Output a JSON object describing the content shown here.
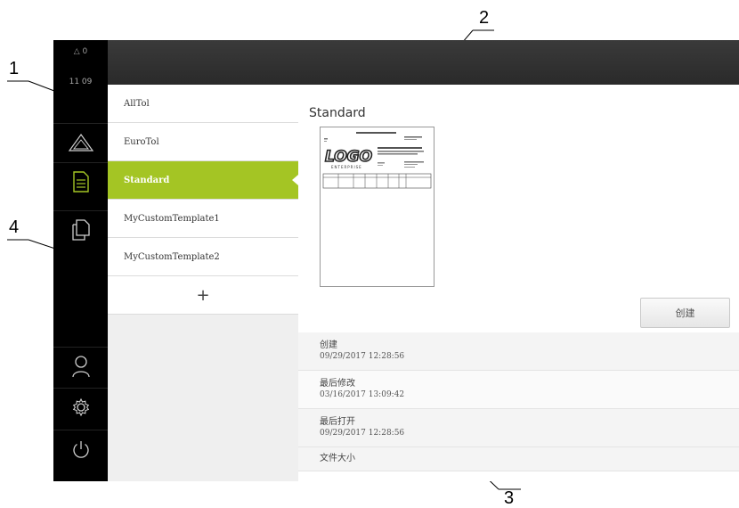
{
  "callouts": [
    "1",
    "2",
    "3",
    "4"
  ],
  "status": {
    "warnings": "0",
    "time": "11 09"
  },
  "nav": {
    "items": [
      {
        "icon": "measure-triangle-icon"
      },
      {
        "icon": "report-document-icon",
        "active": true
      },
      {
        "icon": "copy-documents-icon"
      },
      {
        "icon": "user-icon"
      },
      {
        "icon": "gear-icon"
      },
      {
        "icon": "power-icon"
      }
    ]
  },
  "templates": {
    "items": [
      "AllTol",
      "EuroTol",
      "Standard",
      "MyCustomTemplate1",
      "MyCustomTemplate2"
    ],
    "selected": "Standard",
    "add_label": "+"
  },
  "detail": {
    "title": "Standard",
    "create_button": "创建",
    "info": [
      {
        "label": "创建",
        "value": "09/29/2017 12:28:56"
      },
      {
        "label": "最后修改",
        "value": "03/16/2017 13:09:42"
      },
      {
        "label": "最后打开",
        "value": "09/29/2017 12:28:56"
      },
      {
        "label": "文件大小",
        "value": ""
      }
    ],
    "preview_logo": "LOGO",
    "preview_logo_sub": "ENTERPRISE"
  },
  "colors": {
    "accent": "#a4c524",
    "sidebar": "#000000",
    "topbar": "#2f2f2f"
  }
}
